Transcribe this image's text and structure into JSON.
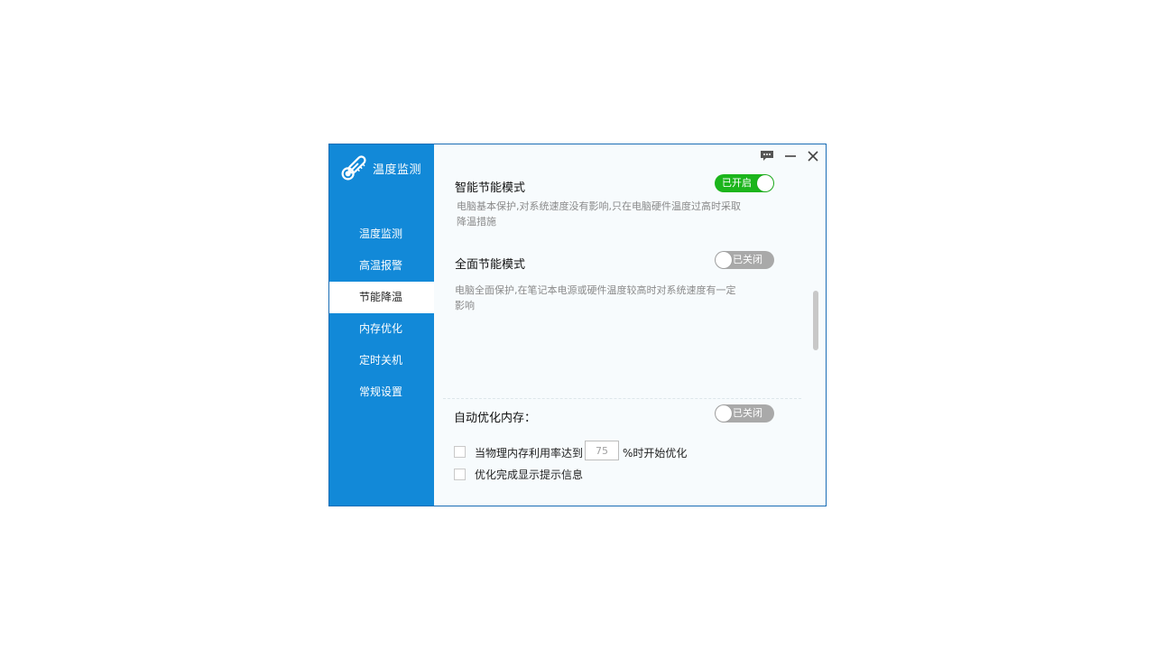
{
  "app": {
    "title": "温度监测"
  },
  "sidebar": {
    "items": [
      {
        "label": "温度监测"
      },
      {
        "label": "高温报警"
      },
      {
        "label": "节能降温"
      },
      {
        "label": "内存优化"
      },
      {
        "label": "定时关机"
      },
      {
        "label": "常规设置"
      }
    ],
    "active_index": 2
  },
  "sections": {
    "smart_mode": {
      "title": "智能节能模式",
      "description": "电脑基本保护,对系统速度没有影响,只在电脑硬件温度过高时采取降温措施",
      "toggle_label": "已开启",
      "enabled": true
    },
    "full_mode": {
      "title": "全面节能模式",
      "description": "电脑全面保护,在笔记本电源或硬件温度较高时对系统速度有一定影响",
      "toggle_label": "已关闭",
      "enabled": false
    },
    "auto_memory": {
      "title": "自动优化内存：",
      "toggle_label": "已关闭",
      "enabled": false,
      "threshold_prefix": "当物理内存利用率达到",
      "threshold_value": "75",
      "threshold_suffix": "%时开始优化",
      "notify_label": "优化完成显示提示信息"
    }
  },
  "colors": {
    "sidebar": "#1289d8",
    "toggle_on": "#1cb51c",
    "toggle_off": "#a9a9a9",
    "border": "#1a6db5"
  },
  "icons": {
    "brand": "thermometer-icon",
    "feedback": "chat-icon",
    "minimize": "minimize-icon",
    "close": "close-icon"
  }
}
